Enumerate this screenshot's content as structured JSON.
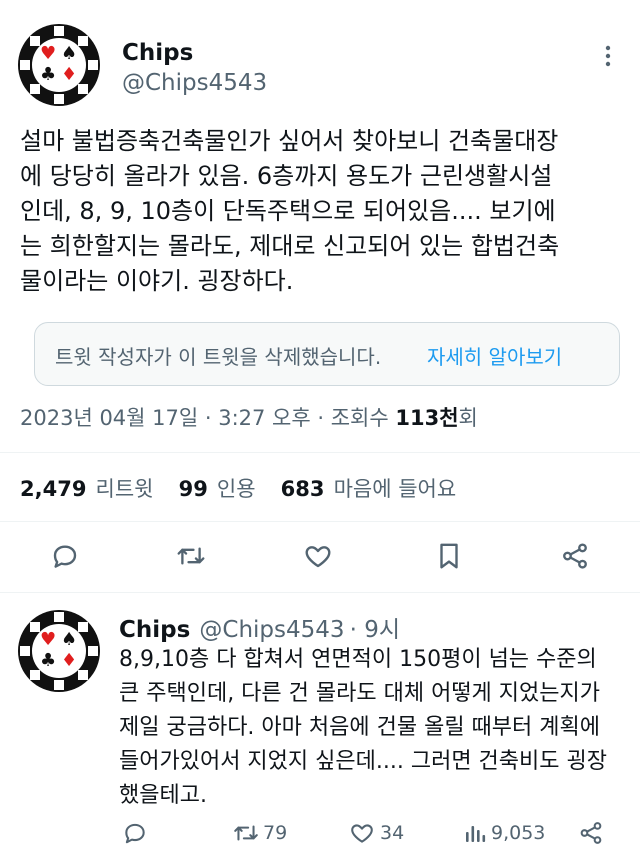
{
  "main_tweet": {
    "author_name": "Chips",
    "author_handle": "@Chips4543",
    "text": "설마 불법증축건축물인가 싶어서 찾아보니 건축물대장\n에 당당히 올라가 있음. 6층까지 용도가 근린생활시설\n인데, 8, 9, 10층이 단독주택으로 되어있음.... 보기에\n는 희한할지는 몰라도, 제대로 신고되어 있는 합법건축\n물이라는 이야기. 굉장하다.",
    "quoted_notice": "트윗 작성자가 이 트윗을 삭제했습니다.",
    "quoted_learn_more": "자세히 알아보기",
    "timestamp": "2023년 04월 17일 · 3:27 오후 · 조회수 ",
    "views_bold": "113천",
    "views_suffix": "회",
    "retweets_count": "2,479",
    "retweets_label": "리트윗",
    "quotes_count": "99",
    "quotes_label": "인용",
    "likes_count": "683",
    "likes_label": "마음에 들어요"
  },
  "reply_tweet": {
    "author_name": "Chips",
    "author_handle": "@Chips4543",
    "time": "· 9시",
    "text": "8,9,10층 다 합쳐서 연면적이 150평이 넘는 수준의\n큰 주택인데, 다른 건 몰라도 대체 어떻게 지었는지가\n제일 궁금하다. 아마 처음에 건물 올릴 때부터 계획에\n들어가있어서 지었지 싶은데.... 그러면 건축비도 굉장\n했을테고.",
    "retweets": "79",
    "likes": "34",
    "views": "9,053"
  },
  "colors": {
    "link": "#1d9bf0",
    "secondary": "#536471",
    "primary": "#0f1419"
  }
}
